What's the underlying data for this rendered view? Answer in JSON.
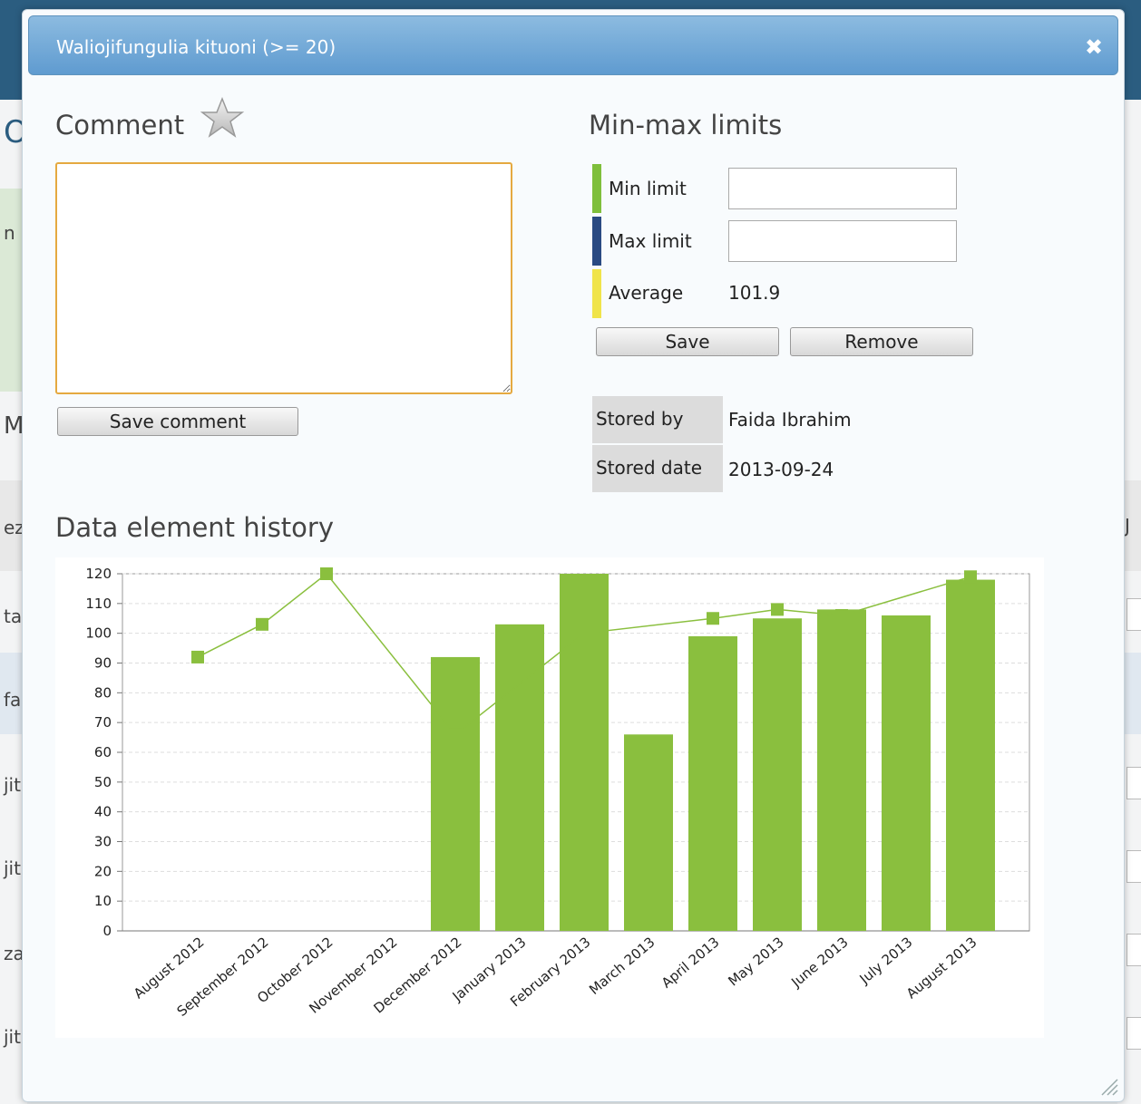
{
  "background": {
    "left_fragments": [
      "O",
      "n",
      "M",
      "ez",
      "ta",
      "fa",
      "jit",
      "jit",
      "za",
      "jit"
    ],
    "right_fragments": [
      "J"
    ]
  },
  "dialog": {
    "title": "Waliojifungulia kituoni (>= 20)",
    "close_icon": "close-icon",
    "comment": {
      "heading": "Comment",
      "star_icon": "star-icon",
      "value": "",
      "save_label": "Save comment"
    },
    "limits": {
      "heading": "Min-max limits",
      "min_label": "Min limit",
      "min_value": "",
      "max_label": "Max limit",
      "max_value": "",
      "avg_label": "Average",
      "avg_value": "101.9",
      "save_label": "Save",
      "remove_label": "Remove",
      "colors": {
        "min": "#7fbf3b",
        "max": "#2a4a82",
        "avg": "#f0e44a"
      }
    },
    "meta": {
      "stored_by_label": "Stored by",
      "stored_by_value": "Faida Ibrahim",
      "stored_date_label": "Stored date",
      "stored_date_value": "2013-09-24"
    },
    "history_heading": "Data element history"
  },
  "chart_data": {
    "type": "bar",
    "categories": [
      "August 2012",
      "September 2012",
      "October 2012",
      "November 2012",
      "December 2012",
      "January 2013",
      "February 2013",
      "March 2013",
      "April 2013",
      "May 2013",
      "June 2013",
      "July 2013",
      "August 2013"
    ],
    "series": [
      {
        "type": "bar",
        "values": [
          null,
          null,
          null,
          null,
          92,
          103,
          120,
          66,
          99,
          105,
          108,
          106,
          118
        ],
        "color": "#8abf3e"
      },
      {
        "type": "line",
        "values": [
          92,
          103,
          120,
          null,
          66,
          null,
          100,
          null,
          105,
          108,
          106,
          null,
          119
        ],
        "color": "#8abf3e"
      }
    ],
    "ylim": [
      0,
      120
    ],
    "yticks": [
      0,
      10,
      20,
      30,
      40,
      50,
      60,
      70,
      80,
      90,
      100,
      110,
      120
    ],
    "grid": true,
    "title": "",
    "xlabel": "",
    "ylabel": ""
  }
}
